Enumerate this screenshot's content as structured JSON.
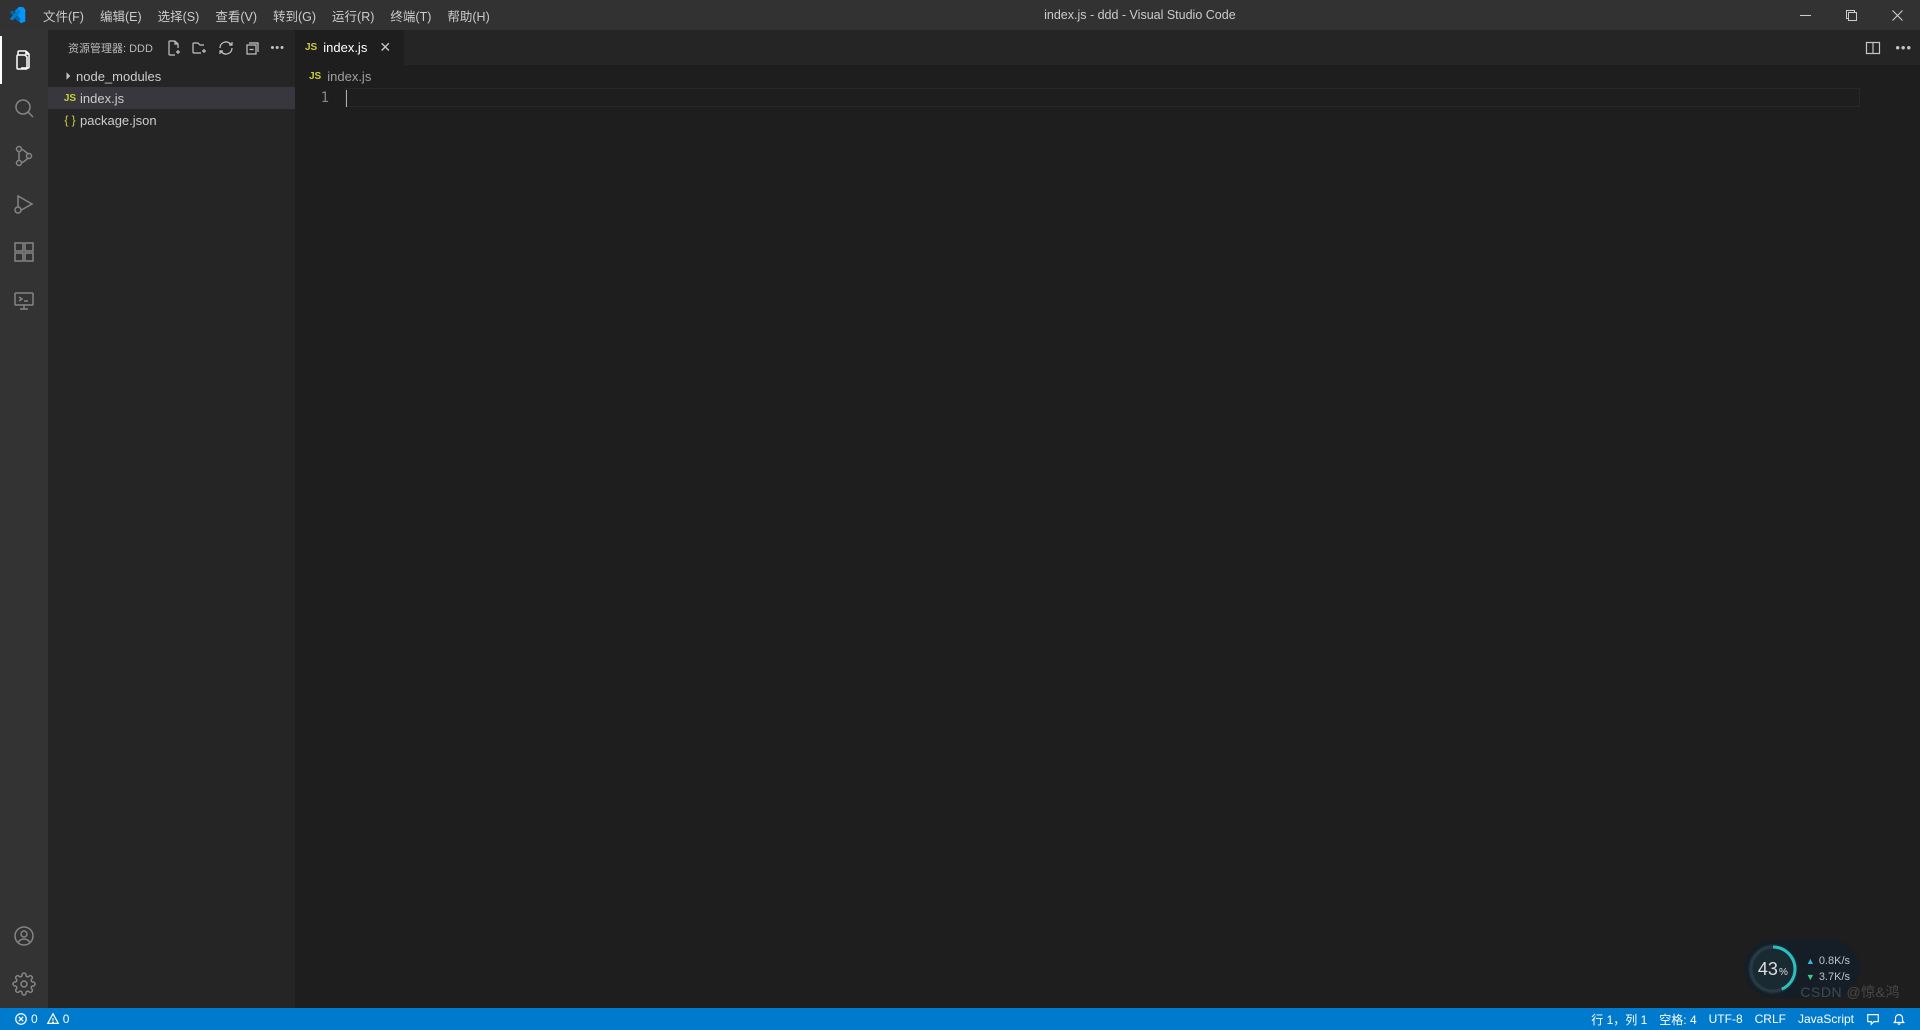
{
  "titlebar": {
    "title": "index.js - ddd - Visual Studio Code"
  },
  "menubar": {
    "items": [
      "文件(F)",
      "编辑(E)",
      "选择(S)",
      "查看(V)",
      "转到(G)",
      "运行(R)",
      "终端(T)",
      "帮助(H)"
    ]
  },
  "sidebar": {
    "header_label": "资源管理器: DDD",
    "files": [
      {
        "name": "node_modules",
        "type": "folder"
      },
      {
        "name": "index.js",
        "type": "js",
        "selected": true
      },
      {
        "name": "package.json",
        "type": "json"
      }
    ]
  },
  "tabs": {
    "items": [
      {
        "name": "index.js",
        "type": "js",
        "active": true
      }
    ]
  },
  "breadcrumbs": {
    "path": "index.js"
  },
  "editor": {
    "line_numbers": [
      "1"
    ]
  },
  "statusbar": {
    "errors": "0",
    "warnings": "0",
    "cursor": "行 1，列 1",
    "indent": "空格: 4",
    "encoding": "UTF-8",
    "eol": "CRLF",
    "language": "JavaScript",
    "feedback_icon": ""
  },
  "net_widget": {
    "percent": "43",
    "up": "0.8K/s",
    "down": "3.7K/s"
  },
  "watermark": "CSDN @惊&鸿"
}
